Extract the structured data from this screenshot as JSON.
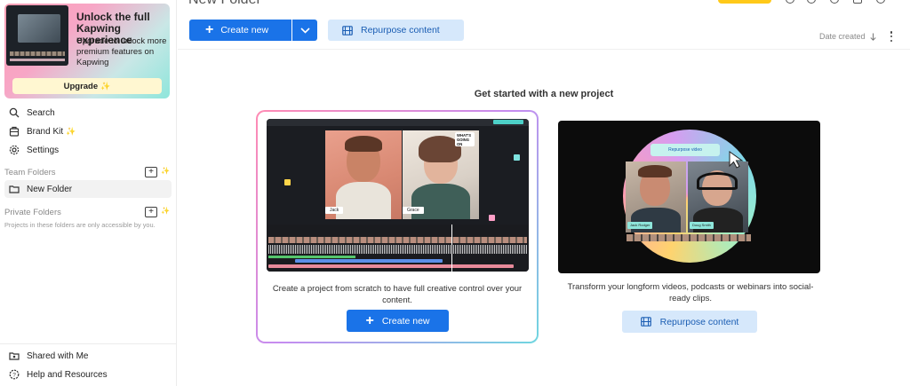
{
  "sidebar": {
    "promo": {
      "title": "Unlock the full Kapwing experience",
      "text": "Upgrade to unlock more premium features on Kapwing",
      "upgrade_label": "Upgrade"
    },
    "nav": [
      {
        "label": "Search",
        "icon": "search-icon"
      },
      {
        "label": "Brand Kit",
        "icon": "brand-kit-icon"
      },
      {
        "label": "Settings",
        "icon": "gear-icon"
      }
    ],
    "team_folders_label": "Team Folders",
    "team_folders": [
      {
        "label": "New Folder"
      }
    ],
    "private_folders_label": "Private Folders",
    "private_note": "Projects in these folders are only accessible by you.",
    "bottom": [
      {
        "label": "Shared with Me",
        "icon": "shared-folder-icon"
      },
      {
        "label": "Help and Resources",
        "icon": "help-icon"
      }
    ]
  },
  "main": {
    "title": "New Folder",
    "toolbar": {
      "create_label": "Create new",
      "repurpose_label": "Repurpose content"
    },
    "sort": {
      "label": "Date created"
    },
    "get_started_heading": "Get started with a new project",
    "cards": [
      {
        "description": "Create a project from scratch to have full creative control over your content.",
        "button_label": "Create new",
        "preview": {
          "name_left": "Jack",
          "name_right": "Grace",
          "bubble": "WHAT'S GOING ON"
        }
      },
      {
        "description": "Transform your longform videos, podcasts or webinars into social-ready clips.",
        "button_label": "Repurpose content",
        "preview": {
          "pill": "Repurpose video",
          "name_left": "Jack Rodger",
          "name_right": "Doug Smith"
        }
      }
    ]
  },
  "colors": {
    "primary": "#1a73e8",
    "secondary_bg": "#d6e8fb",
    "secondary_text": "#1a5db3",
    "accent_yellow": "#ffc919"
  }
}
